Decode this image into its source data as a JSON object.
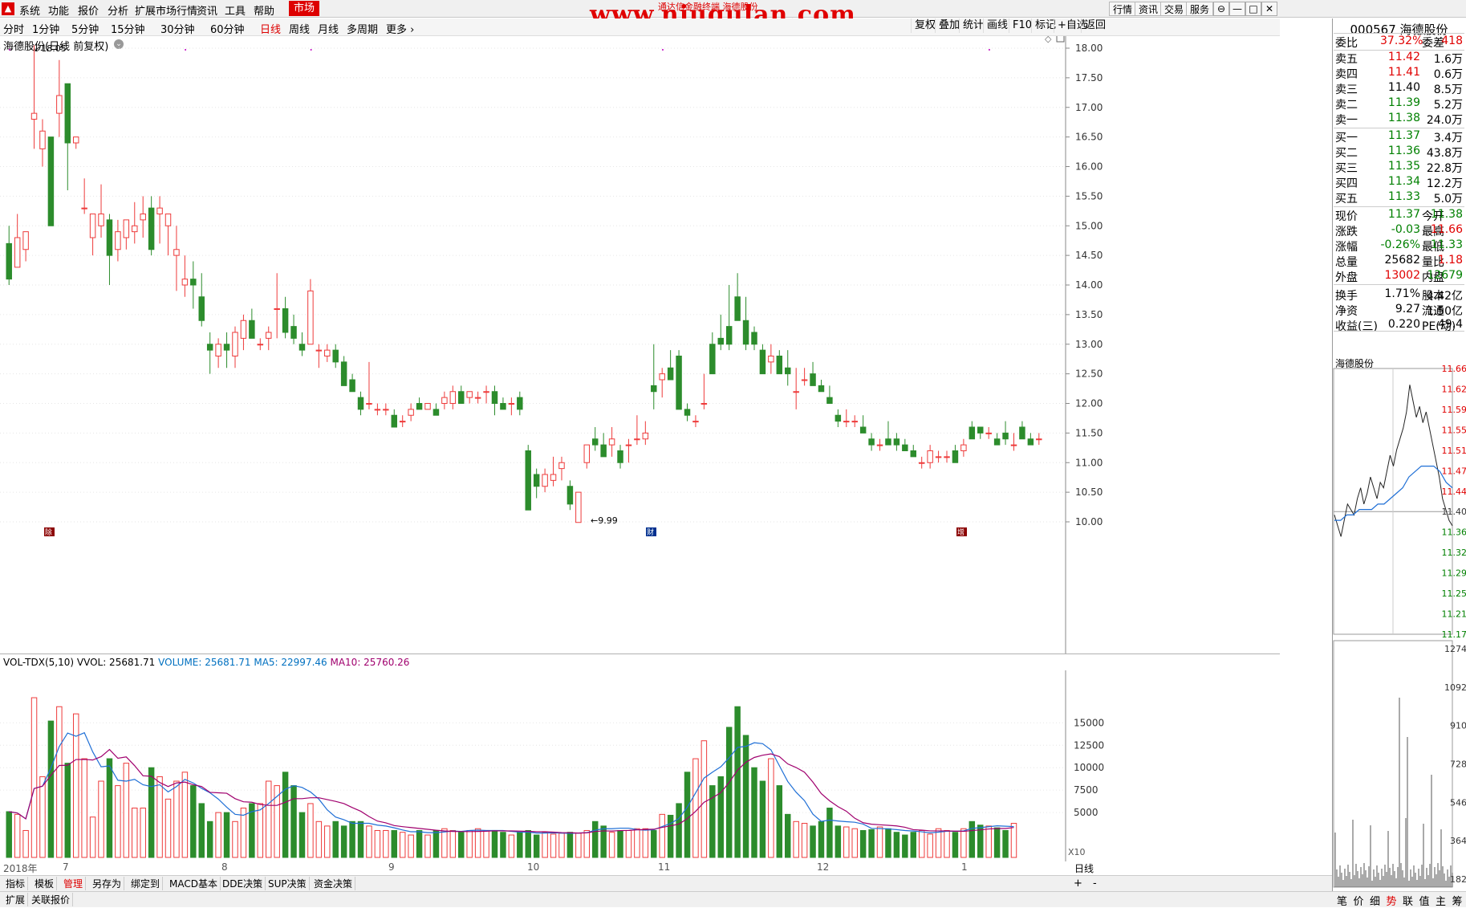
{
  "menubar": {
    "items": [
      "系统",
      "功能",
      "报价",
      "分析",
      "扩展市场行情",
      "资讯",
      "工具",
      "帮助"
    ],
    "active": "市场",
    "right_buttons": [
      "行情",
      "资讯",
      "交易",
      "服务"
    ],
    "window_buttons": [
      "⊖",
      "—",
      "□",
      "✕"
    ]
  },
  "watermark": {
    "text": "www.niugulan.com",
    "sub": "通达信金融终端 海德股份"
  },
  "periods": {
    "items": [
      "分时",
      "1分钟",
      "5分钟",
      "15分钟",
      "30分钟",
      "60分钟",
      "日线",
      "周线",
      "月线",
      "多周期",
      "更多"
    ],
    "active": "日线",
    "tools": [
      "复权",
      "叠加",
      "统计",
      "画线",
      "F10",
      "标记",
      "+自选",
      "返回"
    ]
  },
  "chart": {
    "title": "海德股份(日线 前复权)",
    "high_label": "18.05",
    "low_label": "9.99",
    "y_ticks": [
      "18.00",
      "17.50",
      "17.00",
      "16.50",
      "16.00",
      "15.50",
      "15.00",
      "14.50",
      "14.00",
      "13.50",
      "13.00",
      "12.50",
      "12.00",
      "11.50",
      "11.00",
      "10.50",
      "10.00"
    ],
    "markers": [
      "除",
      "财",
      "增"
    ]
  },
  "volume": {
    "title": "VOL-TDX(5,10)",
    "vvol": "VVOL: 25681.71",
    "volume": "VOLUME: 25681.71",
    "ma5": "MA5: 22997.46",
    "ma10": "MA10: 25760.26",
    "y_ticks": [
      "15000",
      "12500",
      "10000",
      "7500",
      "5000"
    ],
    "scale": "X10"
  },
  "axis": {
    "months": [
      "2018年",
      "7",
      "8",
      "9",
      "10",
      "11",
      "12",
      "1"
    ],
    "period_label": "日线"
  },
  "bottom_tabs": [
    "指标",
    "模板",
    "管理",
    "另存为",
    "绑定到",
    "MACD基本",
    "DDE决策",
    "SUP决策",
    "资金决策"
  ],
  "bottom_tabs_active": "管理",
  "bottom_right": [
    "+",
    "-"
  ],
  "status_tabs": [
    "扩展",
    "关联报价"
  ],
  "quote": {
    "symbol": "000567 海德股份",
    "webi": {
      "label": "委比",
      "value": "37.32%",
      "label2": "委差",
      "value2": "418"
    },
    "asks": [
      {
        "label": "卖五",
        "price": "11.42",
        "vol": "1.6万",
        "color": "#e00000"
      },
      {
        "label": "卖四",
        "price": "11.41",
        "vol": "0.6万",
        "color": "#e00000"
      },
      {
        "label": "卖三",
        "price": "11.40",
        "vol": "8.5万",
        "color": "#000000"
      },
      {
        "label": "卖二",
        "price": "11.39",
        "vol": "5.2万",
        "color": "#008000"
      },
      {
        "label": "卖一",
        "price": "11.38",
        "vol": "24.0万",
        "color": "#008000"
      }
    ],
    "bids": [
      {
        "label": "买一",
        "price": "11.37",
        "vol": "3.4万",
        "color": "#008000"
      },
      {
        "label": "买二",
        "price": "11.36",
        "vol": "43.8万",
        "color": "#008000"
      },
      {
        "label": "买三",
        "price": "11.35",
        "vol": "22.8万",
        "color": "#008000"
      },
      {
        "label": "买四",
        "price": "11.34",
        "vol": "12.2万",
        "color": "#008000"
      },
      {
        "label": "买五",
        "price": "11.33",
        "vol": "5.0万",
        "color": "#008000"
      }
    ],
    "stats": [
      {
        "l1": "现价",
        "v1": "11.37",
        "c1": "#008000",
        "l2": "今开",
        "v2": "11.38",
        "c2": "#008000"
      },
      {
        "l1": "涨跌",
        "v1": "-0.03",
        "c1": "#008000",
        "l2": "最高",
        "v2": "11.66",
        "c2": "#e00000"
      },
      {
        "l1": "涨幅",
        "v1": "-0.26%",
        "c1": "#008000",
        "l2": "最低",
        "v2": "11.33",
        "c2": "#008000"
      },
      {
        "l1": "总量",
        "v1": "25682",
        "c1": "#000000",
        "l2": "量比",
        "v2": "1.18",
        "c2": "#e00000"
      },
      {
        "l1": "外盘",
        "v1": "13002",
        "c1": "#e00000",
        "l2": "内盘",
        "v2": "12679",
        "c2": "#008000"
      },
      {
        "l1": "换手",
        "v1": "1.71%",
        "c1": "#000000",
        "l2": "股本",
        "v2": "4.42亿",
        "c2": "#000000"
      },
      {
        "l1": "净资",
        "v1": "9.27",
        "c1": "#000000",
        "l2": "流通",
        "v2": "1.50亿",
        "c2": "#000000"
      },
      {
        "l1": "收益(三)",
        "v1": "0.220",
        "c1": "#000000",
        "l2": "PE(动)",
        "v2": "49.4",
        "c2": "#000000"
      }
    ],
    "mini_title": "海德股份",
    "mini_prices": [
      "11.66",
      "11.62",
      "11.59",
      "11.55",
      "11.51",
      "11.47",
      "11.44",
      "11.40",
      "11.36",
      "11.32",
      "11.29",
      "11.25",
      "11.21",
      "11.17"
    ],
    "mini_vol": [
      "1274",
      "1092",
      "910",
      "728",
      "546",
      "364",
      "182"
    ],
    "tabs": [
      "笔",
      "价",
      "细",
      "势",
      "联",
      "值",
      "主",
      "筹"
    ],
    "active_tab": "势"
  },
  "chart_data": {
    "type": "candlestick",
    "title": "海德股份(日线 前复权)",
    "ylim": [
      9.8,
      18.2
    ],
    "ohlc": [
      [
        14.7,
        15.0,
        14.0,
        14.1
      ],
      [
        14.3,
        15.2,
        14.3,
        14.8
      ],
      [
        14.6,
        14.8,
        14.4,
        14.9
      ],
      [
        16.8,
        18.05,
        16.3,
        16.9
      ],
      [
        16.3,
        16.8,
        16.0,
        16.6
      ],
      [
        16.5,
        16.5,
        15.0,
        15.0
      ],
      [
        16.9,
        17.8,
        16.5,
        17.2
      ],
      [
        17.4,
        17.4,
        15.6,
        16.4
      ],
      [
        16.4,
        16.5,
        16.3,
        16.5
      ],
      [
        15.3,
        15.8,
        15.2,
        15.3
      ],
      [
        14.8,
        15.2,
        14.5,
        15.2
      ],
      [
        15.0,
        15.7,
        14.8,
        15.2
      ],
      [
        15.1,
        15.2,
        14.0,
        14.5
      ],
      [
        14.6,
        15.1,
        14.4,
        14.9
      ],
      [
        14.8,
        15.0,
        14.6,
        15.1
      ],
      [
        14.9,
        15.4,
        14.7,
        15.0
      ],
      [
        15.1,
        15.5,
        14.8,
        15.2
      ],
      [
        15.3,
        15.5,
        14.5,
        14.6
      ],
      [
        15.2,
        15.5,
        14.7,
        15.3
      ],
      [
        15.0,
        15.2,
        14.5,
        15.2
      ],
      [
        14.5,
        15.0,
        13.9,
        14.6
      ],
      [
        14.0,
        14.5,
        13.8,
        14.1
      ],
      [
        14.1,
        14.4,
        13.6,
        14.0
      ],
      [
        13.8,
        14.2,
        13.3,
        13.4
      ],
      [
        13.0,
        13.2,
        12.5,
        12.9
      ],
      [
        12.8,
        13.1,
        12.6,
        13.0
      ],
      [
        13.0,
        13.2,
        12.6,
        12.9
      ],
      [
        12.8,
        13.3,
        12.6,
        13.2
      ],
      [
        13.1,
        13.5,
        12.9,
        13.4
      ],
      [
        13.4,
        13.6,
        13.3,
        13.1
      ],
      [
        13.0,
        13.1,
        12.9,
        13.0
      ],
      [
        13.1,
        13.3,
        12.9,
        13.2
      ],
      [
        13.6,
        14.2,
        13.1,
        13.6
      ],
      [
        13.6,
        13.8,
        13.1,
        13.2
      ],
      [
        13.3,
        13.5,
        13.0,
        13.1
      ],
      [
        13.0,
        13.2,
        12.8,
        12.9
      ],
      [
        13.0,
        14.1,
        13.0,
        13.9
      ],
      [
        12.9,
        13.0,
        12.6,
        12.9
      ],
      [
        12.8,
        13.0,
        12.7,
        12.9
      ],
      [
        12.9,
        13.0,
        12.6,
        12.7
      ],
      [
        12.7,
        12.8,
        12.3,
        12.3
      ],
      [
        12.4,
        12.5,
        12.2,
        12.2
      ],
      [
        12.1,
        12.2,
        11.8,
        11.9
      ],
      [
        12.0,
        12.7,
        11.9,
        12.0
      ],
      [
        11.9,
        12.0,
        11.8,
        11.9
      ],
      [
        11.9,
        12.0,
        11.8,
        11.9
      ],
      [
        11.8,
        11.9,
        11.6,
        11.6
      ],
      [
        11.7,
        11.8,
        11.6,
        11.7
      ],
      [
        11.8,
        12.0,
        11.7,
        11.9
      ],
      [
        12.0,
        12.1,
        11.9,
        11.9
      ],
      [
        11.9,
        12.0,
        11.9,
        12.0
      ],
      [
        11.9,
        12.0,
        11.8,
        11.8
      ],
      [
        12.0,
        12.2,
        11.9,
        12.1
      ],
      [
        12.0,
        12.3,
        11.9,
        12.2
      ],
      [
        12.2,
        12.3,
        12.0,
        12.0
      ],
      [
        12.1,
        12.2,
        12.0,
        12.2
      ],
      [
        12.1,
        12.2,
        12.0,
        12.1
      ],
      [
        12.2,
        12.3,
        12.0,
        12.2
      ],
      [
        12.2,
        12.3,
        11.8,
        12.0
      ],
      [
        12.0,
        12.1,
        11.9,
        11.9
      ],
      [
        12.0,
        12.1,
        11.8,
        12.0
      ],
      [
        12.1,
        12.2,
        11.8,
        11.9
      ],
      [
        11.2,
        11.3,
        10.2,
        10.2
      ],
      [
        10.8,
        10.9,
        10.4,
        10.6
      ],
      [
        10.6,
        10.9,
        10.5,
        10.8
      ],
      [
        10.7,
        11.1,
        10.6,
        10.8
      ],
      [
        10.9,
        11.1,
        10.7,
        11.0
      ],
      [
        10.6,
        10.7,
        10.2,
        10.3
      ],
      [
        9.99,
        10.5,
        9.99,
        10.5
      ],
      [
        11.0,
        11.3,
        10.9,
        11.3
      ],
      [
        11.4,
        11.6,
        11.2,
        11.3
      ],
      [
        11.3,
        11.5,
        11.1,
        11.1
      ],
      [
        11.3,
        11.6,
        11.1,
        11.4
      ],
      [
        11.2,
        11.3,
        10.9,
        11.0
      ],
      [
        11.3,
        11.4,
        11.0,
        11.3
      ],
      [
        11.4,
        11.8,
        11.3,
        11.4
      ],
      [
        11.4,
        11.7,
        11.3,
        11.5
      ],
      [
        12.3,
        13.0,
        11.9,
        12.2
      ],
      [
        12.4,
        12.6,
        12.1,
        12.5
      ],
      [
        12.6,
        12.9,
        12.4,
        12.4
      ],
      [
        12.8,
        12.9,
        11.9,
        11.9
      ],
      [
        11.9,
        12.0,
        11.7,
        11.8
      ],
      [
        11.7,
        11.8,
        11.6,
        11.7
      ],
      [
        12.0,
        12.5,
        11.9,
        12.0
      ],
      [
        13.0,
        13.2,
        12.6,
        12.5
      ],
      [
        13.1,
        13.5,
        12.9,
        13.0
      ],
      [
        13.3,
        14.0,
        12.9,
        13.0
      ],
      [
        13.8,
        14.2,
        13.4,
        13.4
      ],
      [
        13.4,
        13.8,
        12.9,
        13.0
      ],
      [
        13.2,
        13.3,
        12.9,
        13.0
      ],
      [
        12.9,
        13.0,
        12.6,
        12.5
      ],
      [
        12.7,
        13.0,
        12.5,
        12.8
      ],
      [
        12.8,
        12.9,
        12.5,
        12.5
      ],
      [
        12.6,
        12.9,
        12.3,
        12.5
      ],
      [
        12.2,
        12.6,
        11.9,
        12.2
      ],
      [
        12.4,
        12.6,
        12.3,
        12.4
      ],
      [
        12.5,
        12.7,
        12.3,
        12.3
      ],
      [
        12.3,
        12.4,
        12.2,
        12.2
      ],
      [
        12.1,
        12.3,
        12.0,
        12.0
      ],
      [
        11.8,
        11.9,
        11.6,
        11.7
      ],
      [
        11.7,
        11.9,
        11.6,
        11.7
      ],
      [
        11.7,
        11.8,
        11.6,
        11.7
      ],
      [
        11.6,
        11.8,
        11.5,
        11.5
      ],
      [
        11.4,
        11.5,
        11.2,
        11.3
      ],
      [
        11.3,
        11.4,
        11.2,
        11.3
      ],
      [
        11.4,
        11.7,
        11.3,
        11.3
      ],
      [
        11.4,
        11.5,
        11.2,
        11.3
      ],
      [
        11.3,
        11.4,
        11.2,
        11.2
      ],
      [
        11.2,
        11.3,
        11.1,
        11.1
      ],
      [
        11.0,
        11.1,
        10.9,
        11.0
      ],
      [
        11.0,
        11.3,
        10.9,
        11.2
      ],
      [
        11.1,
        11.2,
        11.0,
        11.1
      ],
      [
        11.1,
        11.2,
        11.0,
        11.1
      ],
      [
        11.2,
        11.3,
        11.0,
        11.0
      ],
      [
        11.2,
        11.4,
        11.1,
        11.3
      ],
      [
        11.6,
        11.7,
        11.5,
        11.4
      ],
      [
        11.6,
        11.6,
        11.4,
        11.5
      ],
      [
        11.5,
        11.6,
        11.4,
        11.5
      ],
      [
        11.4,
        11.5,
        11.3,
        11.3
      ],
      [
        11.5,
        11.7,
        11.3,
        11.4
      ],
      [
        11.3,
        11.5,
        11.2,
        11.3
      ],
      [
        11.6,
        11.7,
        11.4,
        11.4
      ],
      [
        11.4,
        11.5,
        11.3,
        11.3
      ],
      [
        11.4,
        11.5,
        11.3,
        11.4
      ]
    ],
    "volume": [
      5100,
      4800,
      3000,
      17800,
      9000,
      15200,
      16800,
      10500,
      16000,
      11000,
      4500,
      8500,
      11000,
      8000,
      10500,
      5500,
      5500,
      10000,
      9000,
      6500,
      8500,
      9500,
      8000,
      6000,
      4000,
      5000,
      5000,
      4000,
      5500,
      6000,
      6000,
      8500,
      8000,
      9500,
      8000,
      5000,
      6000,
      4000,
      3500,
      4000,
      3500,
      4000,
      4000,
      3500,
      3000,
      3000,
      3000,
      2800,
      2500,
      3000,
      2500,
      3000,
      3200,
      3000,
      2800,
      3000,
      3200,
      3000,
      3000,
      2800,
      2500,
      2800,
      3000,
      2500,
      2800,
      2600,
      2700,
      2800,
      2700,
      3000,
      4000,
      3500,
      2800,
      3000,
      3000,
      3200,
      3200,
      3000,
      4800,
      4700,
      6000,
      9500,
      11000,
      13000,
      8000,
      9000,
      14500,
      16800,
      13600,
      10000,
      8500,
      11000,
      8000,
      4800,
      4000,
      3800,
      3500,
      4000,
      5500,
      3500,
      3400,
      3200,
      3000,
      3100,
      3400,
      3200,
      2800,
      2500,
      2800,
      3000,
      2600,
      3200,
      3000,
      2800,
      3200,
      4000,
      3600,
      3500,
      3300,
      3000,
      3800
    ]
  }
}
